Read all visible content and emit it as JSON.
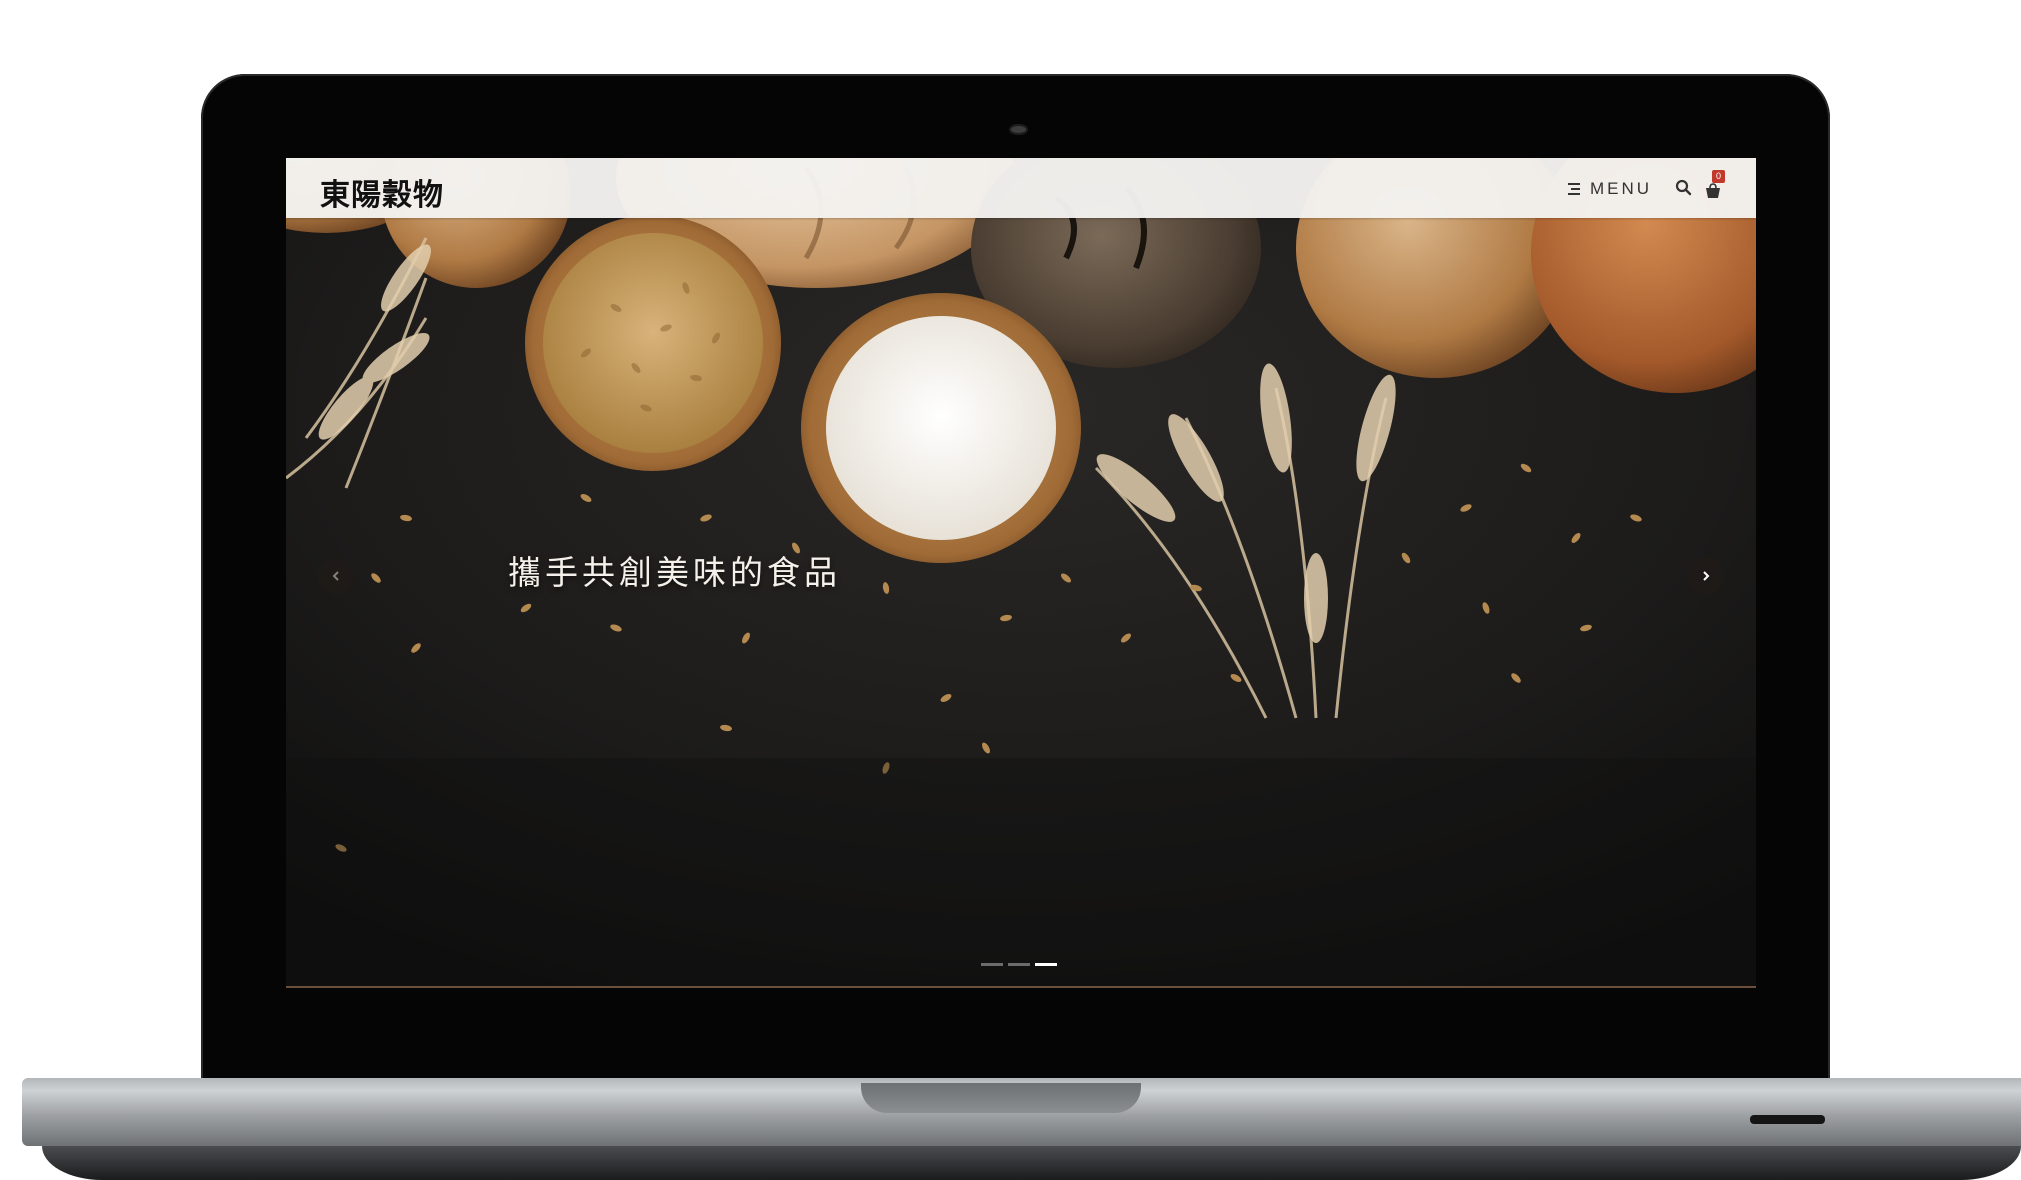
{
  "site": {
    "logo_text": "東陽穀物",
    "menu_label": "MENU",
    "cart_count": "0"
  },
  "hero": {
    "caption": "攜手共創美味的食品",
    "slides_total": 3,
    "active_slide": 3
  },
  "colors": {
    "header_bg": "#f4f2f0",
    "hero_bg": "#1a1a1a",
    "badge": "#c0392b",
    "caption": "#f5f1ea"
  },
  "icons": {
    "menu": "hamburger-icon",
    "search": "search-icon",
    "cart": "cart-icon",
    "prev": "chevron-left-icon",
    "next": "chevron-right-icon"
  }
}
